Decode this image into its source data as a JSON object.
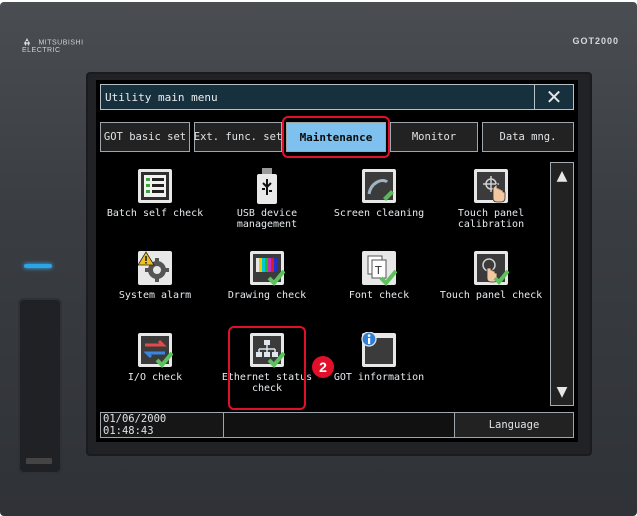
{
  "device": {
    "brand_left": "MITSUBISHI ELECTRIC",
    "brand_right": "GOT2000",
    "led_color": "#2aa6e8"
  },
  "window": {
    "title": "Utility main menu",
    "close_symbol": "✕"
  },
  "tabs": [
    {
      "label": "GOT basic set",
      "active": false
    },
    {
      "label": "Ext. func. set",
      "active": false
    },
    {
      "label": "Maintenance",
      "active": true
    },
    {
      "label": "Monitor",
      "active": false
    },
    {
      "label": "Data mng.",
      "active": false
    }
  ],
  "items": [
    {
      "label": "Batch self check",
      "icon": "batch-self-check-icon"
    },
    {
      "label": "USB device management",
      "icon": "usb-device-icon"
    },
    {
      "label": "Screen cleaning",
      "icon": "screen-cleaning-icon"
    },
    {
      "label": "Touch panel calibration",
      "icon": "touch-calibration-icon"
    },
    {
      "label": "System alarm",
      "icon": "system-alarm-icon"
    },
    {
      "label": "Drawing check",
      "icon": "drawing-check-icon"
    },
    {
      "label": "Font check",
      "icon": "font-check-icon"
    },
    {
      "label": "Touch panel check",
      "icon": "touch-panel-check-icon"
    },
    {
      "label": "I/O check",
      "icon": "io-check-icon"
    },
    {
      "label": "Ethernet status check",
      "icon": "ethernet-status-icon"
    },
    {
      "label": "GOT information",
      "icon": "got-information-icon"
    }
  ],
  "scroll": {
    "up": "▲",
    "down": "▼"
  },
  "status": {
    "datetime": "01/06/2000 01:48:43",
    "language": "Language"
  },
  "annotation": {
    "step_number": "2",
    "highlight_color": "#e0102a"
  }
}
